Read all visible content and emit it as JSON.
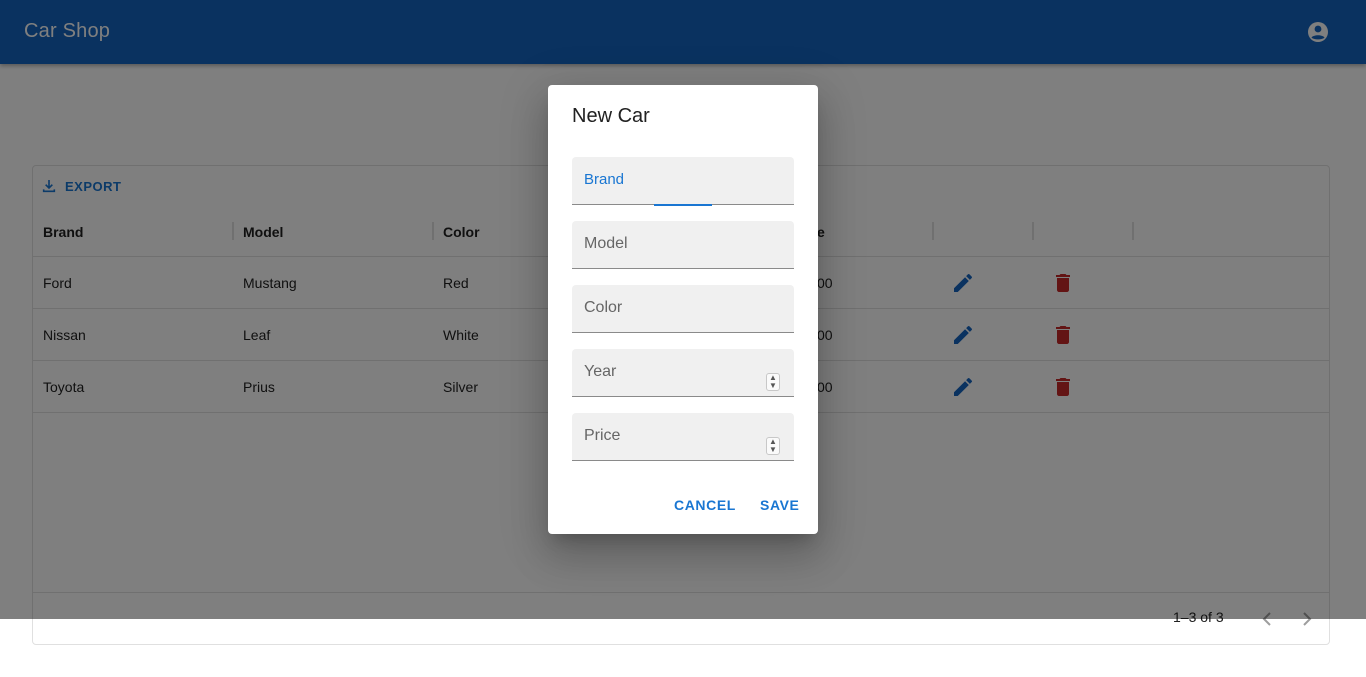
{
  "app": {
    "title": "Car Shop",
    "account_icon": "account-circle-icon"
  },
  "toolbar": {
    "export_label": "EXPORT",
    "export_icon": "download-icon"
  },
  "columns": [
    "Brand",
    "Model",
    "Color",
    "e"
  ],
  "rows": [
    {
      "brand": "Ford",
      "model": "Mustang",
      "color": "Red",
      "price_tail": "00"
    },
    {
      "brand": "Nissan",
      "model": "Leaf",
      "color": "White",
      "price_tail": "00"
    },
    {
      "brand": "Toyota",
      "model": "Prius",
      "color": "Silver",
      "price_tail": "00"
    }
  ],
  "row_actions": {
    "edit_icon": "pencil-icon",
    "delete_icon": "trash-icon"
  },
  "pagination": {
    "info": "1–3 of 3"
  },
  "dialog": {
    "title": "New Car",
    "fields": [
      {
        "label": "Brand"
      },
      {
        "label": "Model"
      },
      {
        "label": "Color"
      },
      {
        "label": "Year"
      },
      {
        "label": "Price"
      }
    ],
    "cancel_label": "CANCEL",
    "save_label": "SAVE"
  },
  "colors": {
    "primary": "#1565c0",
    "accent": "#1976d2",
    "danger": "#c62828"
  }
}
